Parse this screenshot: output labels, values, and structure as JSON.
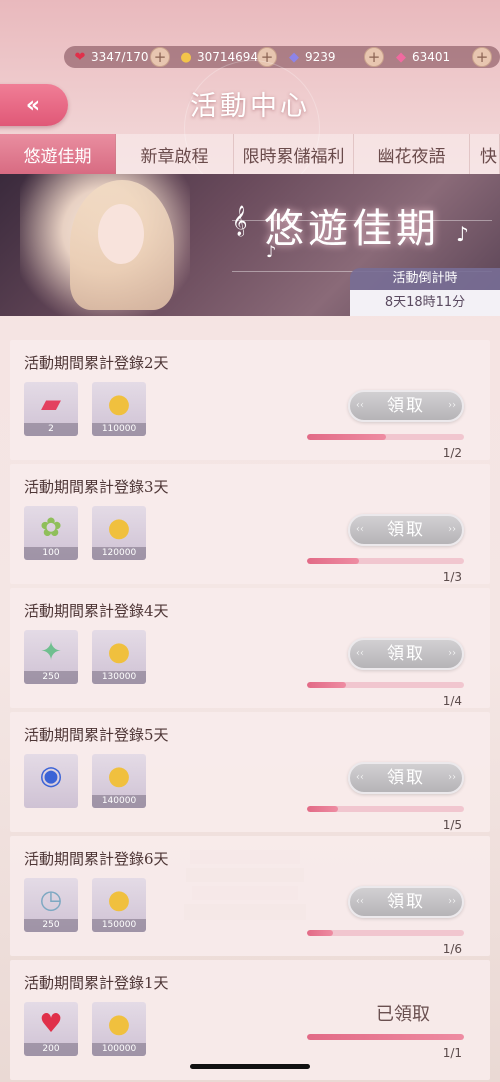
{
  "resources": {
    "stamina": {
      "value": "3347/170",
      "icon": "heart-icon"
    },
    "gold": {
      "value": "30714694",
      "icon": "cat-coin-icon"
    },
    "diamond": {
      "value": "9239",
      "icon": "blue-diamond-icon"
    },
    "pink_diamond": {
      "value": "63401",
      "icon": "pink-diamond-icon"
    }
  },
  "header": {
    "back": "«",
    "title": "活動中心"
  },
  "tabs": [
    "悠遊佳期",
    "新章啟程",
    "限時累儲福利",
    "幽花夜語",
    "快"
  ],
  "banner": {
    "title": "悠遊佳期",
    "countdown_label": "活動倒計時",
    "countdown_value": "8天18時11分"
  },
  "colors": {
    "accent": "#e05877",
    "progress": "#e26a86",
    "claim_button": "#c4c2c5"
  },
  "tasks": [
    {
      "title": "活動期間累計登錄2天",
      "rewards": [
        {
          "icon": "ticket-icon",
          "qty": "2"
        },
        {
          "icon": "gold-coin-icon",
          "qty": "110000"
        }
      ],
      "button": "領取",
      "progress_text": "1/2",
      "progress": 0.5
    },
    {
      "title": "活動期間累計登錄3天",
      "rewards": [
        {
          "icon": "bouquet-icon",
          "qty": "100"
        },
        {
          "icon": "gold-coin-icon",
          "qty": "120000"
        }
      ],
      "button": "領取",
      "progress_text": "1/3",
      "progress": 0.333
    },
    {
      "title": "活動期間累計登錄4天",
      "rewards": [
        {
          "icon": "wand-icon",
          "qty": "250"
        },
        {
          "icon": "gold-coin-icon",
          "qty": "130000"
        }
      ],
      "button": "領取",
      "progress_text": "1/4",
      "progress": 0.25
    },
    {
      "title": "活動期間累計登錄5天",
      "rewards": [
        {
          "icon": "emblem-icon",
          "qty": ""
        },
        {
          "icon": "gold-coin-icon",
          "qty": "140000"
        }
      ],
      "button": "領取",
      "progress_text": "1/5",
      "progress": 0.2
    },
    {
      "title": "活動期間累計登錄6天",
      "rewards": [
        {
          "icon": "clock-icon",
          "qty": "250"
        },
        {
          "icon": "gold-coin-icon",
          "qty": "150000"
        }
      ],
      "button": "領取",
      "progress_text": "1/6",
      "progress": 0.167
    },
    {
      "title": "活動期間累計登錄1天",
      "rewards": [
        {
          "icon": "heart-gem-icon",
          "qty": "200"
        },
        {
          "icon": "gold-coin-icon",
          "qty": "100000"
        }
      ],
      "button": "已領取",
      "progress_text": "1/1",
      "progress": 1.0
    }
  ]
}
